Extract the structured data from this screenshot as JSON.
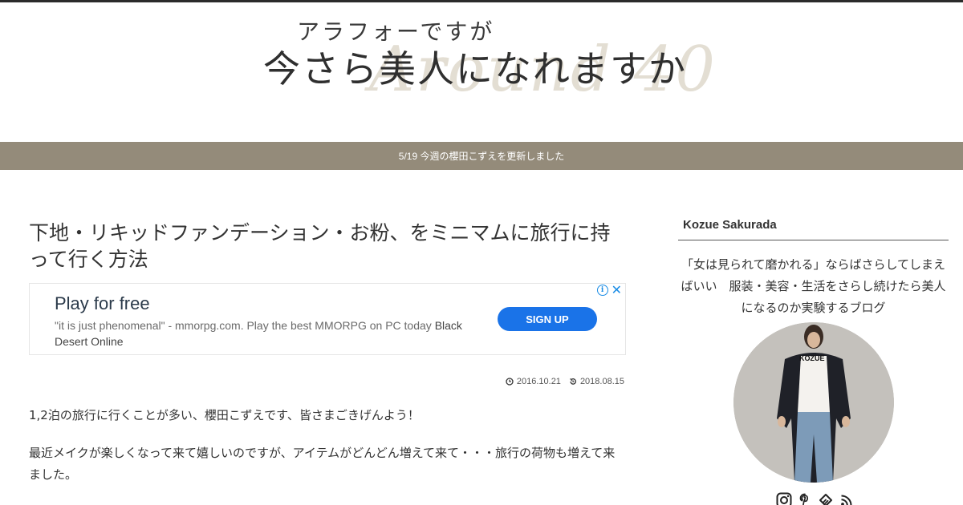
{
  "header": {
    "logo_small": "アラフォーですが",
    "logo_main": "今さら美人になれますか",
    "logo_watermark": "Around 40"
  },
  "notice": {
    "text": "5/19 今週の櫻田こずえを更新しました"
  },
  "post": {
    "title": "下地・リキッドファンデーション・お粉、をミニマムに旅行に持って行く方法",
    "published": "2016.10.21",
    "updated": "2018.08.15",
    "paragraphs": [
      "1,2泊の旅行に行くことが多い、櫻田こずえです、皆さまごきげんよう！",
      "最近メイクが楽しくなって来て嬉しいのですが、アイテムがどんどん増えて来て・・・旅行の荷物も増えて来ました。"
    ]
  },
  "ad": {
    "headline": "Play for free",
    "description": "\"it is just phenomenal\" - mmorpg.com. Play the best MMORPG on PC today",
    "brand": "Black Desert Online",
    "cta": "SIGN UP",
    "info_icon": "info-icon",
    "close_icon": "close-icon",
    "cta_color": "#1a73e8"
  },
  "sidebar": {
    "widget_title": "Kozue Sakurada",
    "profile_text": "「女は見られて磨かれる」ならばさらしてしまえばいい　服装・美容・生活をさらし続けたら美人になるのか実験するブログ",
    "photo_shirt_text": "KOZUE",
    "social": [
      "instagram-icon",
      "pinterest-icon",
      "feedly-icon",
      "rss-icon"
    ]
  },
  "colors": {
    "notice_bar": "#948b7a",
    "top_rule": "#2b2b2b",
    "accent_blue": "#1a73e8"
  }
}
